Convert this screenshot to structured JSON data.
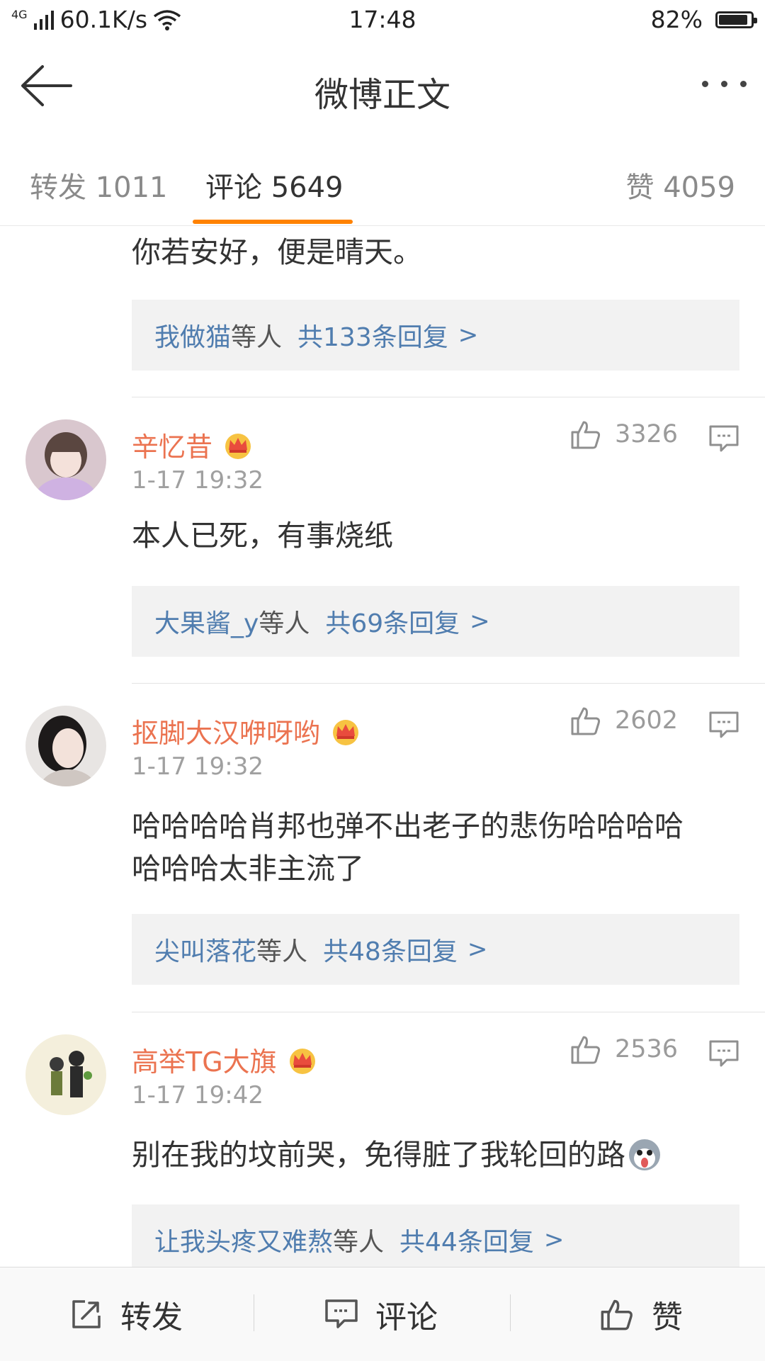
{
  "status_bar": {
    "network": "4G",
    "speed": "60.1K/s",
    "time": "17:48",
    "battery": "82%"
  },
  "nav": {
    "title": "微博正文"
  },
  "tabs": [
    {
      "label": "转发 1011"
    },
    {
      "label": "评论 5649"
    },
    {
      "label": "赞 4059"
    }
  ],
  "comments": [
    {
      "text": "你若安好，便是晴天。",
      "reply": {
        "names": "我做猫",
        "etc": "等人",
        "count": "共133条回复"
      }
    },
    {
      "username": "辛忆昔",
      "time": "1-17 19:32",
      "likes": "3326",
      "text": "本人已死，有事烧纸",
      "reply": {
        "names": "大果酱_y",
        "etc": "等人",
        "count": "共69条回复"
      }
    },
    {
      "username": "抠脚大汉咿呀哟",
      "time": "1-17 19:32",
      "likes": "2602",
      "text_line1": "哈哈哈哈肖邦也弹不出老子的悲伤哈哈哈哈",
      "text_line2": "哈哈哈太非主流了",
      "reply": {
        "names": "尖叫落花",
        "etc": "等人",
        "count": "共48条回复"
      }
    },
    {
      "username": "高举TG大旗",
      "time": "1-17 19:42",
      "likes": "2536",
      "text": "别在我的坟前哭，免得脏了我轮回的路",
      "reply": {
        "names": "让我头疼又难熬",
        "etc": "等人",
        "count": "共44条回复"
      }
    }
  ],
  "bottom_bar": {
    "repost": "转发",
    "comment": "评论",
    "like": "赞"
  },
  "colors": {
    "accent": "#ff8200",
    "username": "#eb7350",
    "link": "#507daf"
  }
}
